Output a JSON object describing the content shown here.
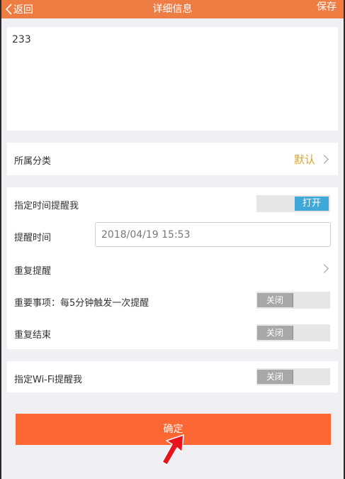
{
  "header": {
    "back_label": "返回",
    "title": "详细信息",
    "save_label": "保存"
  },
  "note": {
    "content": "233"
  },
  "category": {
    "label": "所属分类",
    "value": "默认"
  },
  "reminder": {
    "time_reminder_label": "指定时间提醒我",
    "time_reminder_toggle": "打开",
    "time_label": "提醒时间",
    "time_value": "2018/04/19 15:53",
    "repeat_label": "重复提醒",
    "important_label": "重要事项：每5分钟触发一次提醒",
    "important_toggle": "关闭",
    "repeat_end_label": "重复结束",
    "repeat_end_toggle": "关闭"
  },
  "wifi": {
    "label": "指定Wi-Fi提醒我",
    "toggle": "关闭"
  },
  "confirm_label": "确定",
  "colors": {
    "header": "#ee7d43",
    "confirm": "#fc6734",
    "toggle_on": "#3fa8d8",
    "category_value": "#d8a52a"
  }
}
